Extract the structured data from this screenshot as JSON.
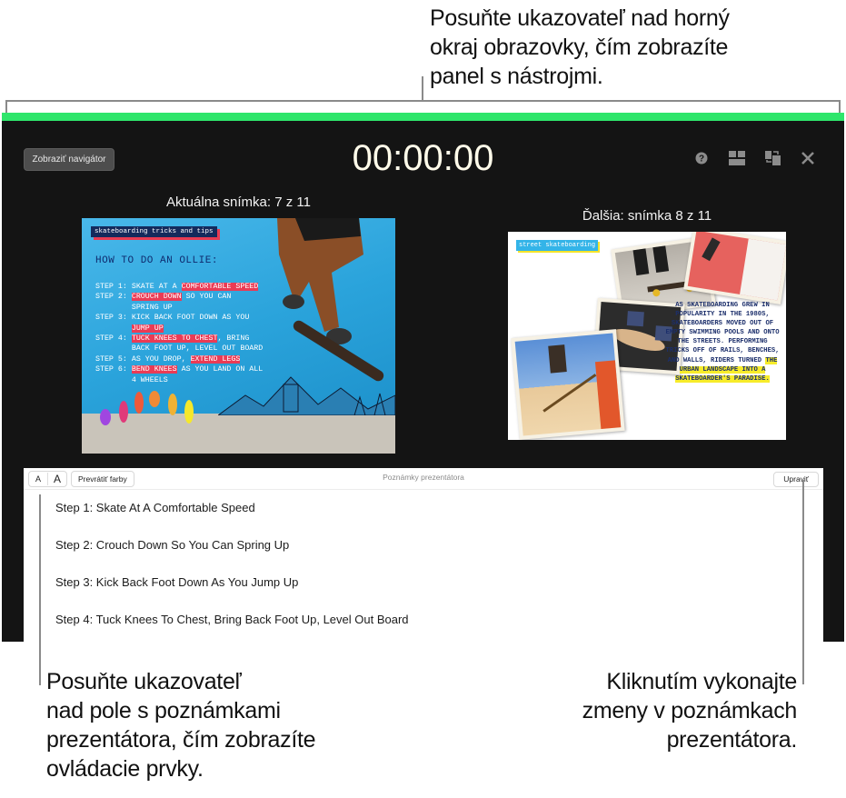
{
  "callouts": {
    "top": "Posuňte ukazovateľ nad horný okraj obrazovky, čím zobrazíte panel s nástrojmi.",
    "top_lines": [
      "Posuňte ukazovateľ nad horný",
      "okraj obrazovky, čím zobrazíte",
      "panel s nástrojmi."
    ],
    "left_lines": [
      "Posuňte ukazovateľ",
      "nad pole s poznámkami",
      "prezentátora, čím zobrazíte",
      "ovládacie prvky."
    ],
    "right_lines": [
      "Kliknutím vykonajte",
      "zmeny v poznámkach",
      "prezentátora."
    ]
  },
  "presenter": {
    "show_navigator_label": "Zobraziť navigátor",
    "timer": "00:00:00",
    "accent_color": "#2ee66b",
    "icons": [
      "help-icon",
      "layout-icon",
      "swap-displays-icon",
      "close-icon"
    ],
    "current_label": "Aktuálna snímka: 7 z 11",
    "next_label": "Ďalšia: snímka 8 z 11"
  },
  "current_slide": {
    "tag": "skateboarding tricks and tips",
    "heading": "HOW TO DO AN OLLIE:",
    "steps": [
      {
        "prefix": "STEP 1: ",
        "parts": [
          [
            "SKATE AT A ",
            false
          ],
          [
            "COMFORTABLE SPEED",
            true
          ]
        ]
      },
      {
        "prefix": "STEP 2: ",
        "parts": [
          [
            "CROUCH DOWN",
            true
          ],
          [
            " SO YOU CAN",
            false
          ]
        ]
      },
      {
        "prefix": "        ",
        "parts": [
          [
            "SPRING UP",
            false
          ]
        ]
      },
      {
        "prefix": "STEP 3: ",
        "parts": [
          [
            "KICK BACK FOOT DOWN AS YOU",
            false
          ]
        ]
      },
      {
        "prefix": "        ",
        "parts": [
          [
            "JUMP UP",
            true
          ]
        ]
      },
      {
        "prefix": "STEP 4: ",
        "parts": [
          [
            "TUCK KNEES TO CHEST",
            true
          ],
          [
            ", BRING",
            false
          ]
        ]
      },
      {
        "prefix": "        ",
        "parts": [
          [
            "BACK FOOT UP, LEVEL OUT BOARD",
            false
          ]
        ]
      },
      {
        "prefix": "STEP 5: ",
        "parts": [
          [
            "AS YOU DROP, ",
            false
          ],
          [
            "EXTEND LEGS",
            true
          ]
        ]
      },
      {
        "prefix": "STEP 6: ",
        "parts": [
          [
            "BEND KNEES",
            true
          ],
          [
            " AS YOU LAND ON ALL",
            false
          ]
        ]
      },
      {
        "prefix": "        ",
        "parts": [
          [
            "4 WHEELS",
            false
          ]
        ]
      }
    ]
  },
  "next_slide": {
    "tag": "street skateboarding",
    "paragraph_plain": "AS SKATEBOARDING GREW IN POPULARITY IN THE 1980S, SKATEBOARDERS MOVED OUT OF EMPTY SWIMMING POOLS AND ONTO THE STREETS. PERFORMING TRICKS OFF OF RAILS, BENCHES, AND WALLS, RIDERS TURNED ",
    "paragraph_highlight": "THE URBAN LANDSCAPE INTO A SKATEBOARDER'S PARADISE."
  },
  "notes": {
    "font_smaller_label": "A",
    "font_larger_label": "A",
    "invert_label": "Prevrátiť farby",
    "title": "Poznámky prezentátora",
    "edit_label": "Upraviť",
    "lines": [
      "Step 1: Skate At A Comfortable Speed",
      "Step 2: Crouch Down So You Can Spring Up",
      "Step 3: Kick Back Foot Down As You Jump Up",
      "Step 4: Tuck Knees To Chest, Bring Back Foot Up, Level Out Board"
    ]
  }
}
